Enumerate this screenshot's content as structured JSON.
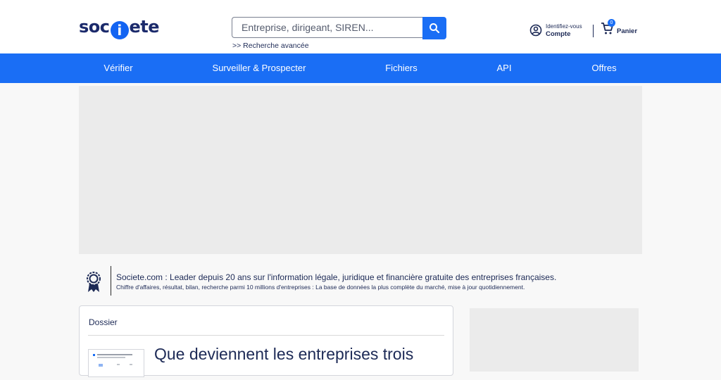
{
  "header": {
    "logo": {
      "before": "soc",
      "i": "i",
      "after": "ete"
    },
    "search": {
      "placeholder": "Entreprise, dirigeant, SIREN...",
      "value": ""
    },
    "advanced_link": ">> Recherche avancée",
    "account": {
      "small_label": "Identifiez-vous",
      "label": "Compte"
    },
    "cart": {
      "count": "0",
      "label": "Panier"
    }
  },
  "nav": {
    "items": [
      {
        "label": "Vérifier"
      },
      {
        "label": "Surveiller & Prospecter"
      },
      {
        "label": "Fichiers"
      },
      {
        "label": "API"
      },
      {
        "label": "Offres"
      }
    ]
  },
  "info": {
    "headline": "Societe.com : Leader depuis 20 ans sur l'information légale, juridique et financière gratuite des entreprises françaises.",
    "subline": "Chiffre d'affaires, résultat, bilan, recherche parmi 10 millions d'entreprises : La base de données la plus complète du marché, mise à jour quotidiennement."
  },
  "dossier": {
    "section_title": "Dossier",
    "headline": "Que deviennent les entreprises trois"
  },
  "colors": {
    "brand_blue": "#1a6ef5",
    "navy": "#1d2a56",
    "ad_gray": "#ebebeb"
  },
  "icons": [
    "search-icon",
    "account-icon",
    "cart-icon",
    "medal-icon"
  ]
}
